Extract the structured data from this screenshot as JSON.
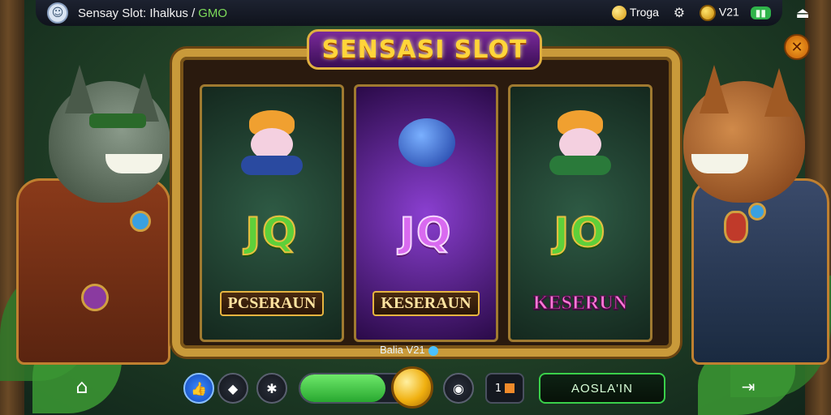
{
  "topbar": {
    "title": "Sensay Slot: Ihalkus /",
    "title_suffix": "GMO",
    "gem_label": "Troga",
    "coin_value": "V21",
    "avatar_icon": "avatar-icon",
    "settings_icon": "gear-icon",
    "exit_icon": "exit-icon"
  },
  "logo": {
    "text": "SENSASI SLOT"
  },
  "reels": [
    {
      "symbols": [
        "JQ",
        "PCSERAUN"
      ],
      "theme": "green"
    },
    {
      "symbols": [
        "JQ",
        "KESERAUN"
      ],
      "theme": "purple"
    },
    {
      "symbols": [
        "JO",
        "KESERUN"
      ],
      "theme": "green"
    }
  ],
  "bet": {
    "label": "Balia V21"
  },
  "controls": {
    "action_label": "AOSLA'IN",
    "square_label": "1",
    "bet_level": 0.72
  },
  "colors": {
    "accent_gold": "#c99a3a",
    "accent_green": "#3ad04a",
    "accent_purple": "#8a3fd0"
  }
}
